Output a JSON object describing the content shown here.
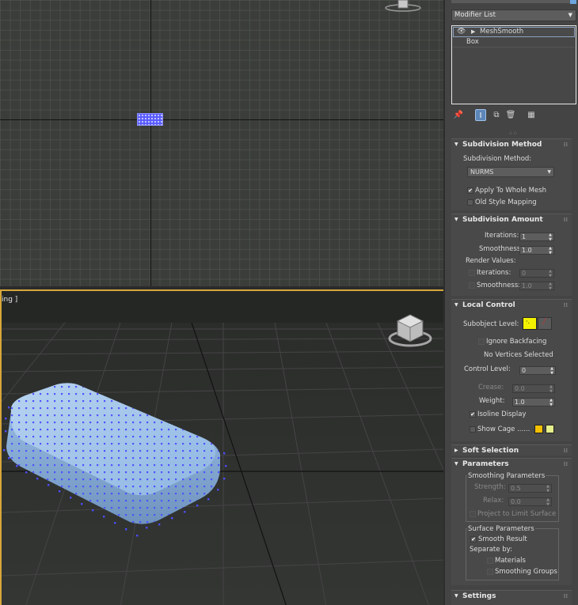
{
  "viewports": {
    "perspective_label": "ing ]"
  },
  "panel": {
    "modifier_list": "Modifier List",
    "stack": [
      {
        "label": "MeshSmooth"
      },
      {
        "label": "Box"
      }
    ],
    "rollouts": {
      "subdivision_method": {
        "title": "Subdivision Method",
        "method_label": "Subdivision Method:",
        "method_value": "NURMS",
        "apply_whole": "Apply To Whole Mesh",
        "apply_whole_checked": "✔",
        "old_style": "Old Style Mapping"
      },
      "subdivision_amount": {
        "title": "Subdivision Amount",
        "iterations_label": "Iterations:",
        "iterations_value": "1",
        "smoothness_label": "Smoothness:",
        "smoothness_value": "1.0",
        "render_values": "Render Values:",
        "render_iterations_label": "Iterations:",
        "render_iterations_value": "0",
        "render_smoothness_label": "Smoothness:",
        "render_smoothness_value": "1.0"
      },
      "local_control": {
        "title": "Local Control",
        "subobject_label": "Subobject Level:",
        "ignore_backfacing": "Ignore Backfacing",
        "no_vertices": "No Vertices Selected",
        "control_level_label": "Control Level:",
        "control_level_value": "0",
        "crease_label": "Crease:",
        "crease_value": "0.0",
        "weight_label": "Weight:",
        "weight_value": "1.0",
        "isoline_display": "Isoline Display",
        "isoline_checked": "✔",
        "show_cage": "Show Cage ......",
        "cage_color1": "#f5c000",
        "cage_color2": "#e6f08a"
      },
      "soft_selection": {
        "title": "Soft Selection"
      },
      "parameters": {
        "title": "Parameters",
        "smoothing_params": "Smoothing Parameters",
        "strength_label": "Strength:",
        "strength_value": "0.5",
        "relax_label": "Relax:",
        "relax_value": "0.0",
        "project_limit": "Project to Limit Surface",
        "surface_params": "Surface Parameters",
        "smooth_result": "Smooth Result",
        "smooth_result_checked": "✔",
        "separate_by": "Separate by:",
        "materials": "Materials",
        "smoothing_groups": "Smoothing Groups"
      },
      "settings": {
        "title": "Settings"
      }
    }
  },
  "colors": {
    "viewport_active_border": "#d7a73a",
    "selection_blue": "#5a5cff",
    "box_surface": "#9bc4ec"
  }
}
